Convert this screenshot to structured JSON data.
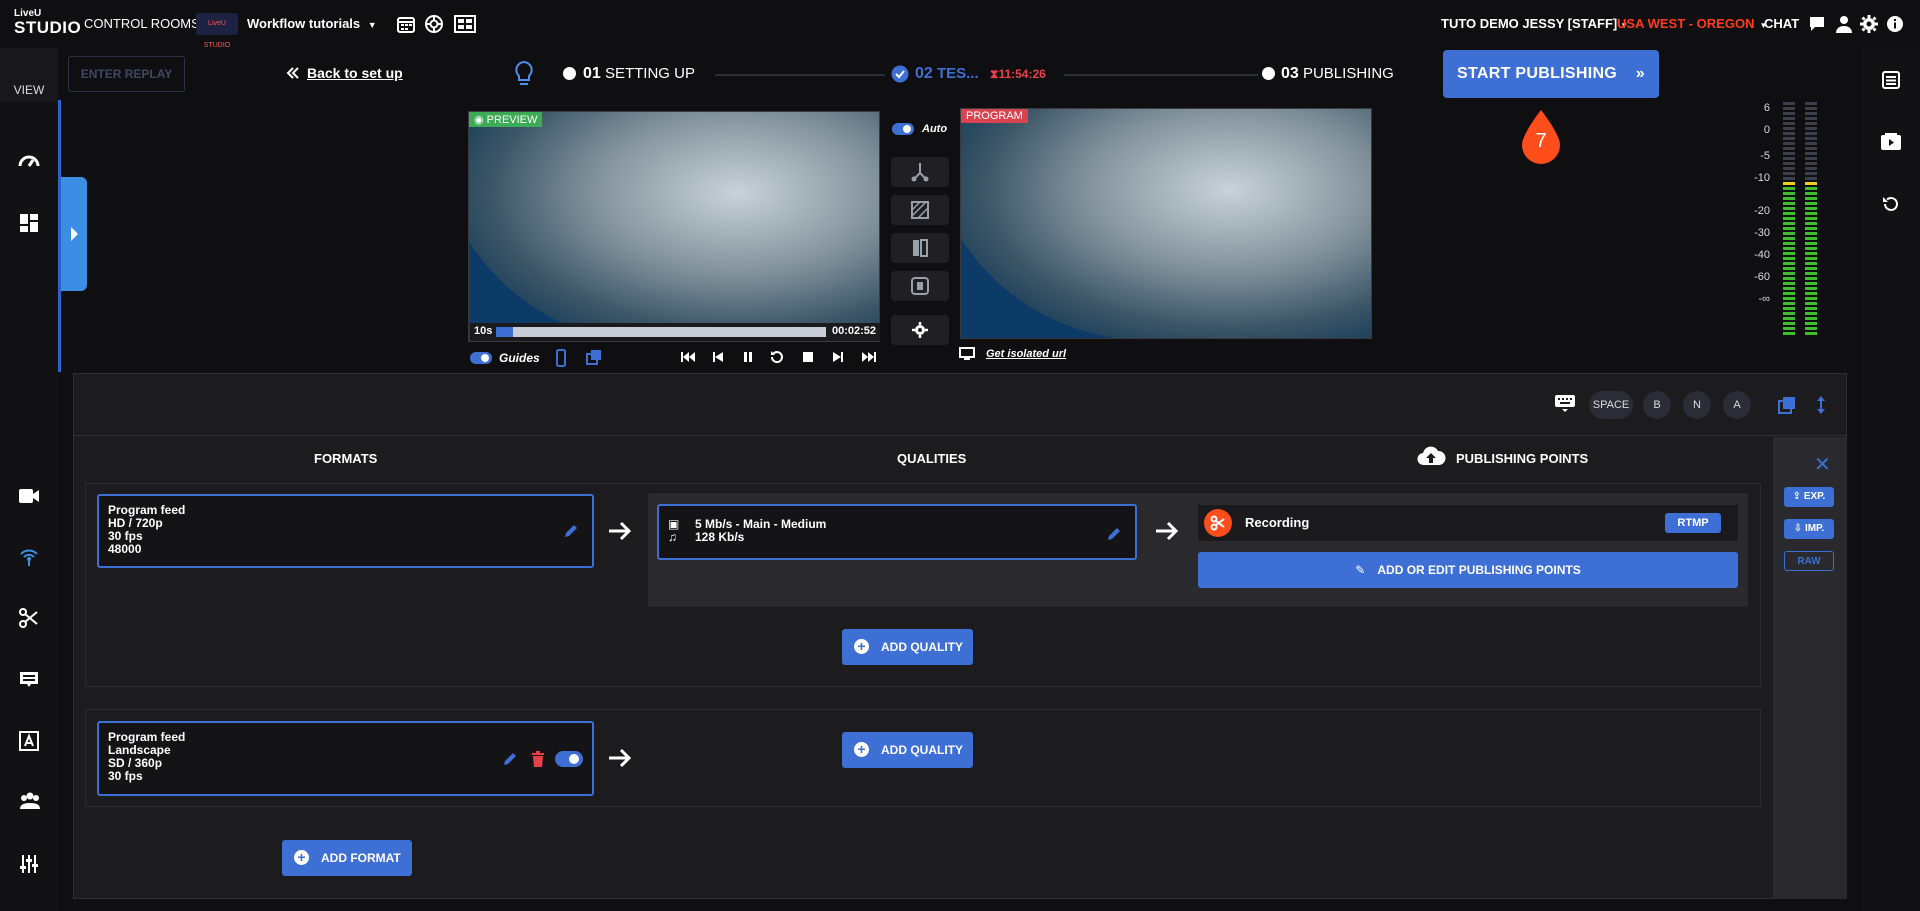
{
  "topbar": {
    "logo_top": "LiveU",
    "logo_bottom": "STUDIO",
    "control_rooms": "CONTROL ROOMS",
    "room_logo": "LiveU STUDIO",
    "workflow": "Workflow tutorials",
    "user": "TUTO DEMO JESSY [STAFF]",
    "region": "USA WEST - OREGON",
    "chat": "CHAT",
    "region_color": "#ff3b1f"
  },
  "leftrail": {
    "view_label": "VIEW",
    "icons": [
      "dashboard-icon",
      "layout-icon",
      "camera-icon",
      "antenna-icon",
      "scissors-icon",
      "subtitles-icon",
      "text-icon",
      "users-icon",
      "sliders-icon"
    ]
  },
  "progress": {
    "replay_label": "ENTER REPLAY",
    "back_label": "Back to set up",
    "step1_num": "01",
    "step1_label": "SETTING UP",
    "step2_num": "02",
    "step2_label": "TES...",
    "timer": "11:54:26",
    "step3_num": "03",
    "step3_label": "PUBLISHING",
    "publish_button": "START PUBLISHING",
    "badge_number": "7"
  },
  "video": {
    "preview_label": "PREVIEW",
    "program_label": "PROGRAM",
    "auto_label": "Auto",
    "scrub_start": "10s",
    "scrub_end": "00:02:52",
    "scrub_progress": 0.05,
    "guides_label": "Guides",
    "isolated_url": "Get isolated url"
  },
  "vu_meter": {
    "scale": [
      "6",
      "0",
      "-5",
      "-10",
      "-20",
      "-30",
      "-40",
      "-60",
      "-∞"
    ]
  },
  "panel": {
    "shortcut_keys": [
      "SPACE",
      "B",
      "N",
      "A"
    ],
    "col_formats": "FORMATS",
    "col_qualities": "QUALITIES",
    "col_publishing": "PUBLISHING POINTS",
    "format1": {
      "title": "Program feed",
      "line1": "HD / 720p",
      "line2": "30 fps",
      "line3": "48000"
    },
    "quality1": {
      "video": "5 Mb/s  -  Main  -  Medium",
      "audio": "128 Kb/s"
    },
    "publishing_point": {
      "name": "Recording",
      "protocol": "RTMP"
    },
    "add_edit_points": "ADD OR EDIT PUBLISHING POINTS",
    "add_quality_1": "ADD QUALITY",
    "format2": {
      "title": "Program feed",
      "line1": "Landscape",
      "line2": "SD / 360p",
      "line3": "30 fps"
    },
    "add_quality_2": "ADD QUALITY",
    "add_format": "ADD FORMAT",
    "side_exp": "EXP.",
    "side_imp": "IMP.",
    "side_raw": "RAW"
  }
}
